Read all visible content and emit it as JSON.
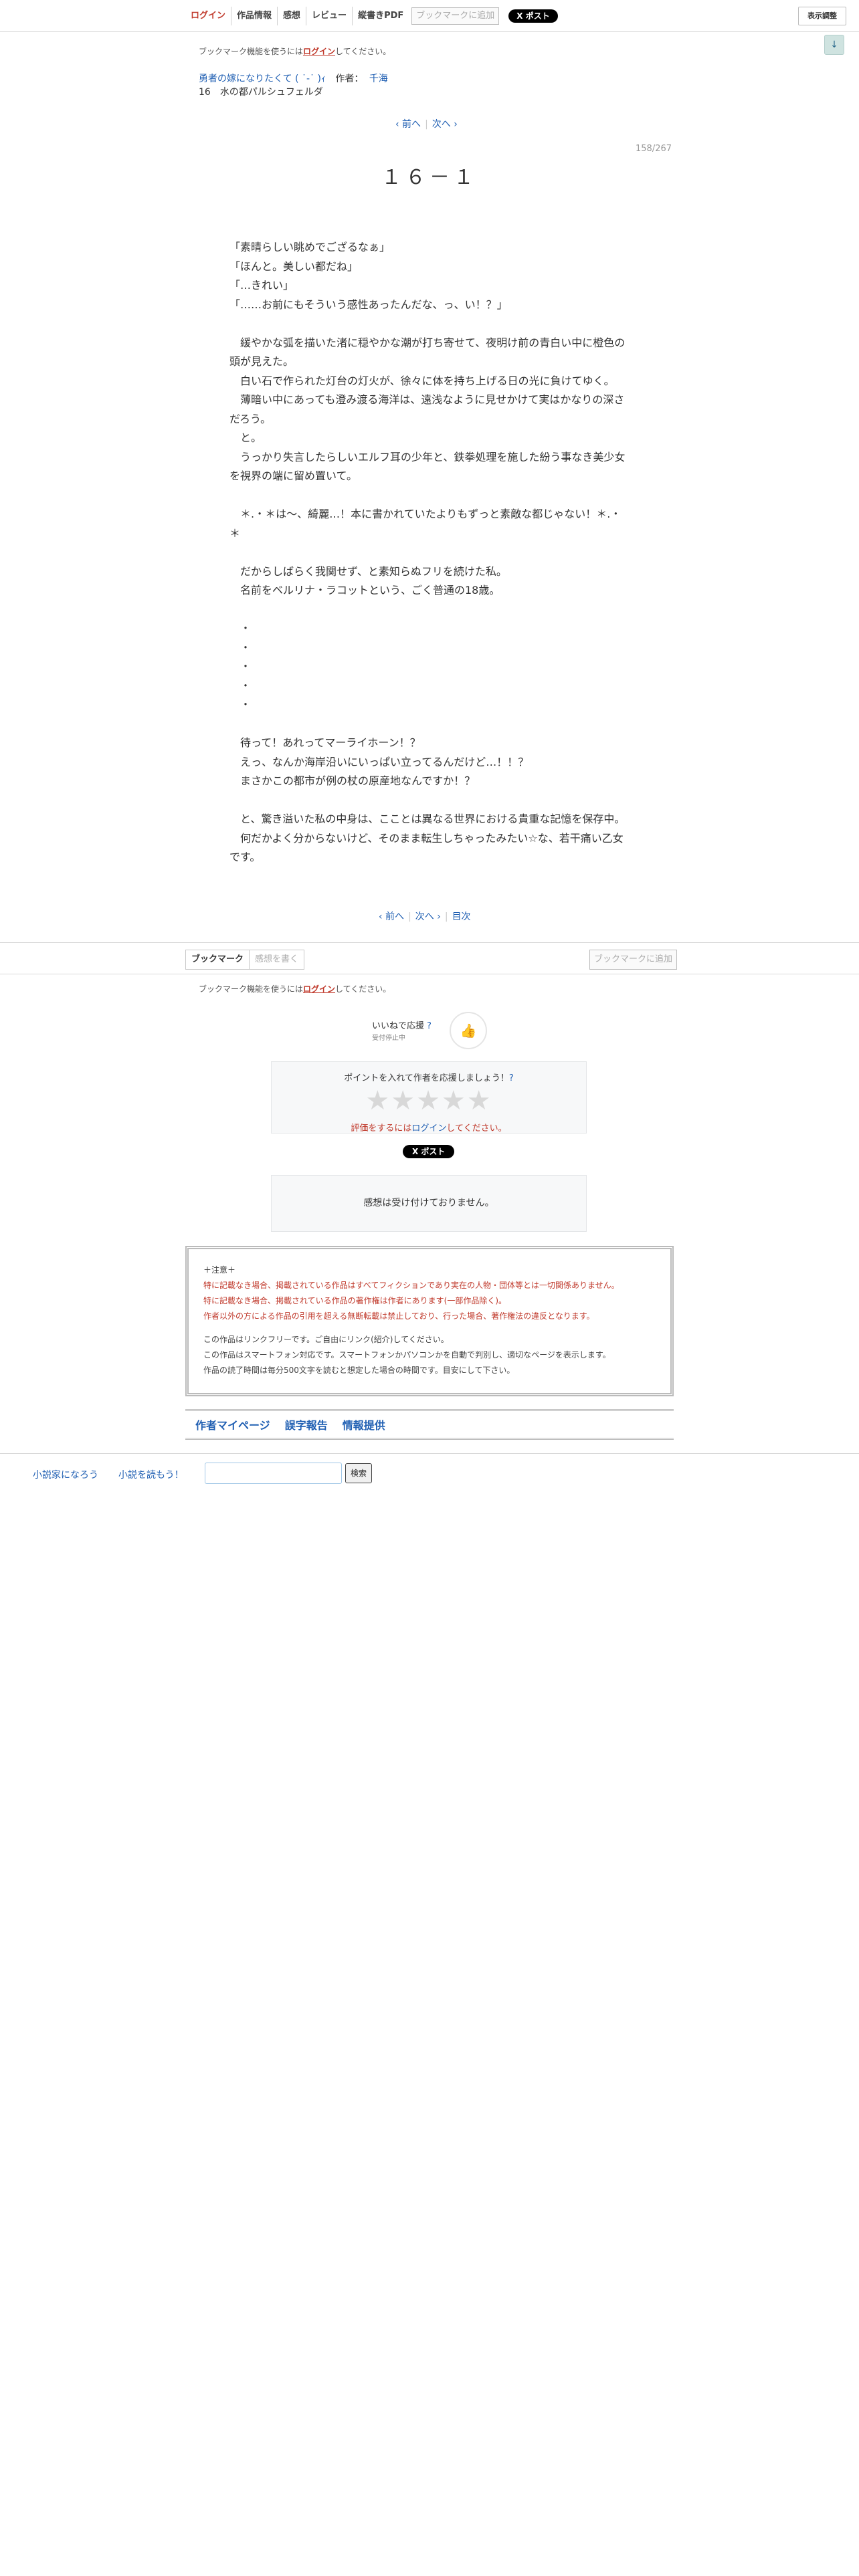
{
  "header": {
    "nav": [
      "ログイン",
      "作品情報",
      "感想",
      "レビュー",
      "縦書きPDF"
    ],
    "bookmark_button": "ブックマークに追加",
    "x_post": "X ポスト",
    "display_adjust": "表示調整",
    "side_arrow": "↓"
  },
  "bookmark_notice": {
    "prefix": "ブックマーク機能を使うには",
    "login": "ログイン",
    "suffix": "してください。"
  },
  "novel": {
    "title": "勇者の嫁になりたくて ( ˙-˙ )ｨ",
    "author_label": "作者：",
    "author": "千海",
    "chapter": "16　水の都パルシュフェルダ"
  },
  "pager": {
    "prev": "‹ 前へ",
    "next": "次へ ›",
    "toc": "目次"
  },
  "page_count": "158/267",
  "subtitle": "１６－１",
  "body_lines": [
    "「素晴らしい眺めでござるなぁ」",
    "「ほんと。美しい都だね」",
    "「…きれい」",
    "「……お前にもそういう感性あったんだな、っ、い！？」",
    "",
    "　緩やかな弧を描いた渚に穏やかな潮が打ち寄せて、夜明け前の青白い中に橙色の",
    "頭が見えた。",
    "　白い石で作られた灯台の灯火が、徐々に体を持ち上げる日の光に負けてゆく。",
    "　薄暗い中にあっても澄み渡る海洋は、遠浅なように見せかけて実はかなりの深さ",
    "だろう。",
    "　と。",
    "　うっかり失言したらしいエルフ耳の少年と、鉄拳処理を施した紛う事なき美少女",
    "を視界の端に留め置いて。",
    "",
    "　＊.・＊は〜、綺麗…！本に書かれていたよりもずっと素敵な都じゃない！＊.・",
    "＊",
    "",
    "　だからしばらく我関せず、と素知らぬフリを続けた私。",
    "　名前をベルリナ・ラコットという、ごく普通の18歳。",
    "",
    "　・",
    "　・",
    "　・",
    "　・",
    "　・",
    "",
    "　待って！あれってマーライホーン！？",
    "　えっ、なんか海岸沿いにいっぱい立ってるんだけど…！！？",
    "　まさかこの都市が例の杖の原産地なんですか！？",
    "",
    "　と、驚き溢いた私の中身は、こことは異なる世界における貴重な記憶を保存中。",
    "　何だかよく分からないけど、そのまま転生しちゃったみたい☆な、若干痛い乙女",
    "です。"
  ],
  "bottom_bar": {
    "bookmark_tab": "ブックマーク",
    "write_impression": "感想を書く",
    "bookmark_button": "ブックマークに追加"
  },
  "iine": {
    "label": "いいねで応援",
    "help": "?",
    "sub": "受付停止中"
  },
  "rating": {
    "lead": "ポイントを入れて作者を応援しましょう！",
    "help": "?",
    "stars": "★★★★★",
    "note_prefix": "評価をするには",
    "note_login": "ログイン",
    "note_suffix": "してください。"
  },
  "impression": "感想は受け付けておりません。",
  "caution": {
    "head": "＋注意＋",
    "red_lines": [
      "特に記載なき場合、掲載されている作品はすべてフィクションであり実在の人物・団体等とは一切関係ありません。",
      "特に記載なき場合、掲載されている作品の著作権は作者にあります(一部作品除く)。",
      "作者以外の方による作品の引用を超える無断転載は禁止しており、行った場合、著作権法の違反となります。"
    ],
    "gray_lines": [
      "この作品はリンクフリーです。ご自由にリンク(紹介)してください。",
      "この作品はスマートフォン対応です。スマートフォンかパソコンかを自動で判別し、適切なページを表示します。",
      "作品の読了時間は毎分500文字を読むと想定した場合の時間です。目安にして下さい。"
    ]
  },
  "footer_links": [
    "作者マイページ",
    "誤字報告",
    "情報提供"
  ],
  "site_footer": {
    "link1": "小説家になろう",
    "link2": "小説を読もう！",
    "search_button": "検索"
  },
  "colors": {
    "link": "#2160b3",
    "alert": "#c0392b"
  }
}
